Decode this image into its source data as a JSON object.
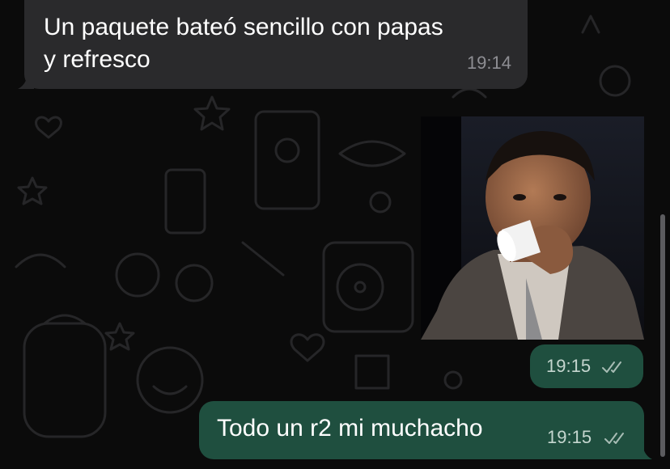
{
  "messages": [
    {
      "direction": "incoming",
      "text_line1": "Un paquete bateó sencillo con papas",
      "text_line2": "y refresco",
      "time": "19:14"
    },
    {
      "direction": "outgoing",
      "type": "image",
      "image_description": "boy sipping from a small white cup",
      "time": "19:15",
      "status_icon": "double-check-icon"
    },
    {
      "direction": "outgoing",
      "text": "Todo un r2 mi muchacho",
      "time": "19:15",
      "status_icon": "double-check-icon"
    }
  ],
  "colors": {
    "background": "#0b0b0b",
    "incoming_bubble": "#2a2a2c",
    "outgoing_bubble": "#1f4f3f",
    "meta_text": "#8e8e93",
    "ticks": "#a7bcb4"
  }
}
